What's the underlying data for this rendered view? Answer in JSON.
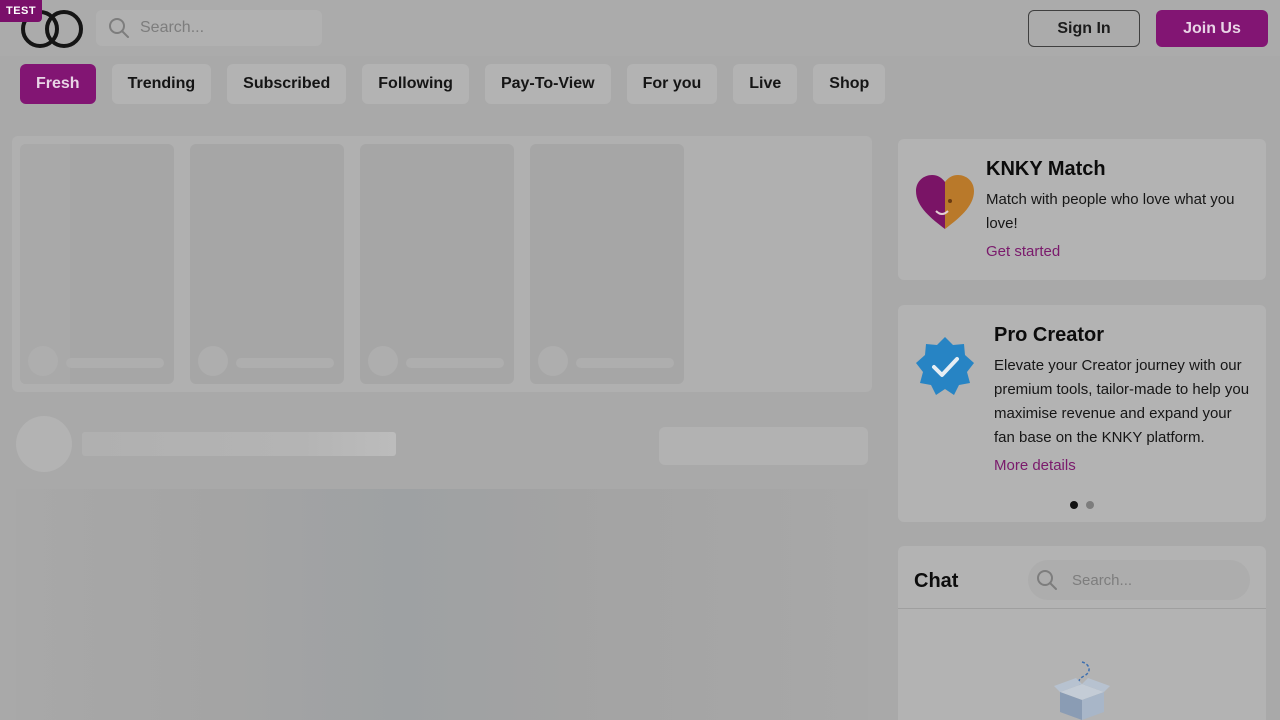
{
  "header": {
    "env_badge": "TEST",
    "search_placeholder": "Search...",
    "sign_in_label": "Sign In",
    "join_label": "Join Us"
  },
  "tabs": [
    {
      "label": "Fresh",
      "active": true
    },
    {
      "label": "Trending",
      "active": false
    },
    {
      "label": "Subscribed",
      "active": false
    },
    {
      "label": "Following",
      "active": false
    },
    {
      "label": "Pay-To-View",
      "active": false
    },
    {
      "label": "For you",
      "active": false
    },
    {
      "label": "Live",
      "active": false
    },
    {
      "label": "Shop",
      "active": false
    }
  ],
  "sidebar": {
    "match_card": {
      "title": "KNKY Match",
      "description": "Match with people who love what you love!",
      "link": "Get started",
      "icon": "heart-match-icon"
    },
    "pro_card": {
      "title": "Pro Creator",
      "description": "Elevate your Creator journey with our premium tools, tailor-made to help you maximise revenue and expand your fan base on the KNKY platform.",
      "link": "More details",
      "icon": "verified-badge-icon",
      "carousel_active_index": 0,
      "carousel_count": 2
    },
    "chat": {
      "title": "Chat",
      "search_placeholder": "Search...",
      "empty_icon": "empty-box-icon"
    }
  },
  "colors": {
    "brand": "#821573",
    "link": "#7a1a6c",
    "match_left": "#7a1466",
    "match_right": "#b9792a",
    "verified": "#2784c4"
  }
}
